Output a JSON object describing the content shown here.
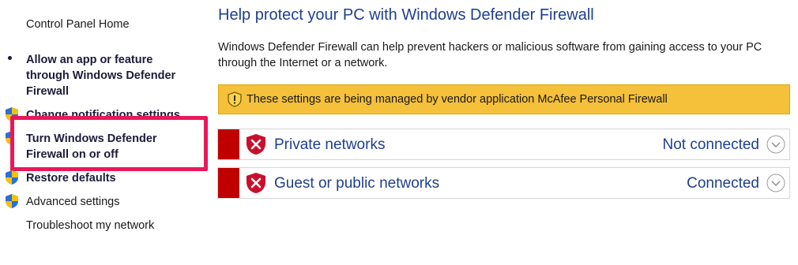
{
  "sidebar": {
    "home": "Control Panel Home",
    "allow_app": [
      "Allow an app or feature",
      "through Windows Defender",
      "Firewall"
    ],
    "change_notifications": "Change notification settings",
    "turn_on_off": [
      "Turn Windows Defender",
      "Firewall on or off"
    ],
    "restore": "Restore defaults",
    "advanced": "Advanced settings",
    "troubleshoot": "Troubleshoot my network"
  },
  "main": {
    "title": "Help protect your PC with Windows Defender Firewall",
    "description": "Windows Defender Firewall can help prevent hackers or malicious software from gaining access to your PC through the Internet or a network.",
    "warning": "These settings are being managed by vendor application McAfee  Personal Firewall",
    "networks": [
      {
        "name": "Private networks",
        "status": "Not connected"
      },
      {
        "name": "Guest or public networks",
        "status": "Connected"
      }
    ]
  },
  "colors": {
    "accent_blue": "#1f3f8f",
    "highlight": "#e8195a",
    "warning_bg": "#f5c03a",
    "network_red": "#c00000"
  },
  "icons": [
    "shield-icon",
    "warning-icon",
    "red-shield-x-icon",
    "chevron-down-icon"
  ]
}
